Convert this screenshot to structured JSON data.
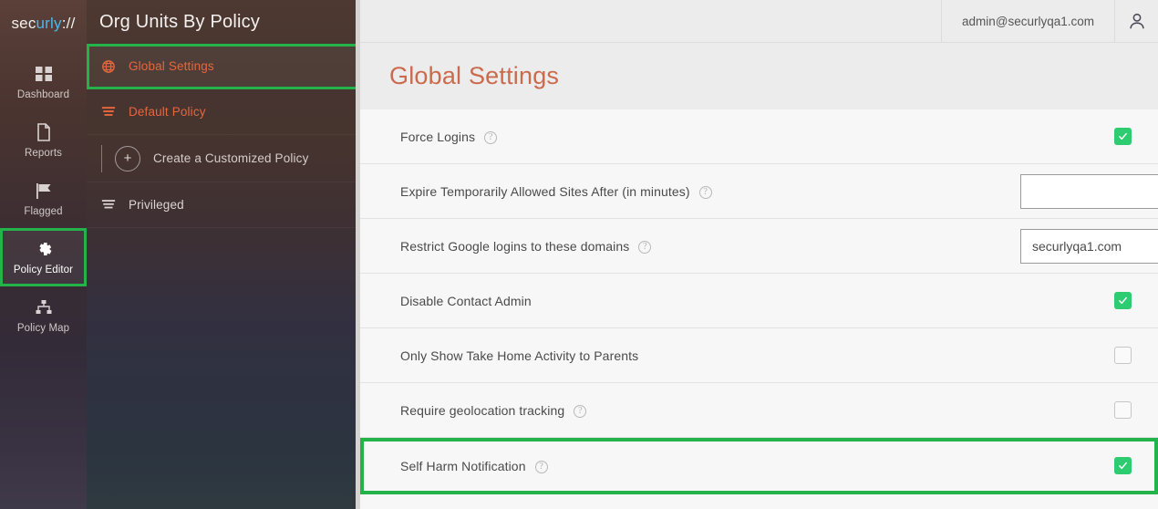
{
  "brand": {
    "logo_white_1": "sec",
    "logo_blue": "urly",
    "logo_white_2": "://"
  },
  "rail": {
    "items": [
      {
        "label": "Dashboard",
        "icon": "dashboard-grid-icon",
        "active": false
      },
      {
        "label": "Reports",
        "icon": "document-icon",
        "active": false
      },
      {
        "label": "Flagged",
        "icon": "flag-icon",
        "active": false
      },
      {
        "label": "Policy Editor",
        "icon": "gear-icon",
        "active": true
      },
      {
        "label": "Policy Map",
        "icon": "sitemap-icon",
        "active": false
      }
    ]
  },
  "panel": {
    "title": "Org Units By Policy",
    "rows": [
      {
        "label": "Global Settings",
        "icon": "globe-icon",
        "selected": true
      },
      {
        "label": "Default Policy",
        "icon": "list-icon",
        "selected": false
      },
      {
        "label": "Create a Customized Policy",
        "icon": "plus-circle-icon",
        "selected": false
      },
      {
        "label": "Privileged",
        "icon": "list-icon",
        "selected": false
      }
    ]
  },
  "topbar": {
    "user_email": "admin@securlyqa1.com",
    "avatar_icon": "user-avatar-icon"
  },
  "page": {
    "title": "Global Settings"
  },
  "settings": {
    "rows": [
      {
        "label": "Force Logins",
        "has_help": true,
        "control": "checkbox",
        "checked": true,
        "highlighted": false
      },
      {
        "label": "Expire Temporarily Allowed Sites After (in minutes)",
        "has_help": true,
        "control": "text",
        "value": "",
        "placeholder": "",
        "highlighted": false
      },
      {
        "label": "Restrict Google logins to these domains",
        "has_help": true,
        "control": "text",
        "value": "securlyqa1.com",
        "placeholder": "",
        "highlighted": false
      },
      {
        "label": "Disable Contact Admin",
        "has_help": false,
        "control": "checkbox",
        "checked": true,
        "highlighted": false
      },
      {
        "label": "Only Show Take Home Activity to Parents",
        "has_help": false,
        "control": "checkbox",
        "checked": false,
        "highlighted": false
      },
      {
        "label": "Require geolocation tracking",
        "has_help": true,
        "control": "checkbox",
        "checked": false,
        "highlighted": false
      },
      {
        "label": "Self Harm Notification",
        "has_help": true,
        "control": "checkbox",
        "checked": true,
        "highlighted": true
      }
    ],
    "help_glyph": "?"
  },
  "colors": {
    "accent_orange": "#e4673c",
    "title_orange": "#cb6a4d",
    "highlight_green": "#24b24b",
    "checkbox_green": "#2ecc71",
    "logo_blue": "#4fb6e8"
  }
}
